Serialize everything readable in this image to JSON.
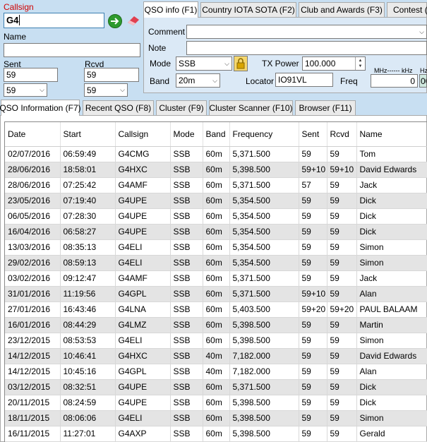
{
  "left": {
    "callsign_label": "Callsign",
    "callsign_value": "G4",
    "name_label": "Name",
    "name_value": "",
    "sent_label": "Sent",
    "sent_value": "59",
    "sent_select": "59",
    "rcvd_label": "Rcvd",
    "rcvd_value": "59",
    "rcvd_select": "59"
  },
  "top_tabs": [
    {
      "label": "QSO info (F1)"
    },
    {
      "label": "Country IOTA SOTA (F2)"
    },
    {
      "label": "Club and Awards (F3)"
    },
    {
      "label": "Contest (F"
    }
  ],
  "qso_panel": {
    "comment_label": "Comment",
    "comment_value": "",
    "note_label": "Note",
    "note_value": "",
    "mode_label": "Mode",
    "mode_value": "SSB",
    "tx_power_label": "TX Power",
    "tx_power_value": "100.000",
    "band_label": "Band",
    "band_value": "20m",
    "locator_label": "Locator",
    "locator_value": "IO91VL",
    "freq_label": "Freq",
    "mhz_khz_label": "MHz------ kHz",
    "hz_label": "Hz",
    "freq_khz_value": "0",
    "freq_hz_value": "00"
  },
  "bottom_tabs": [
    {
      "label": "QSO Information (F7)"
    },
    {
      "label": "Recent QSO (F8)"
    },
    {
      "label": "Cluster (F9)"
    },
    {
      "label": "Cluster Scanner (F10)"
    },
    {
      "label": "Browser (F11)"
    }
  ],
  "table": {
    "headers": [
      "Date",
      "Start",
      "Callsign",
      "Mode",
      "Band",
      "Frequency",
      "Sent",
      "Rcvd",
      "Name"
    ],
    "rows": [
      [
        "02/07/2016",
        "06:59:49",
        "G4CMG",
        "SSB",
        "60m",
        "5,371.500",
        "59",
        "59",
        "Tom"
      ],
      [
        "28/06/2016",
        "18:58:01",
        "G4HXC",
        "SSB",
        "60m",
        "5,398.500",
        "59+10",
        "59+10",
        "David Edwards"
      ],
      [
        "28/06/2016",
        "07:25:42",
        "G4AMF",
        "SSB",
        "60m",
        "5,371.500",
        "57",
        "59",
        "Jack"
      ],
      [
        "23/05/2016",
        "07:19:40",
        "G4UPE",
        "SSB",
        "60m",
        "5,354.500",
        "59",
        "59",
        "Dick"
      ],
      [
        "06/05/2016",
        "07:28:30",
        "G4UPE",
        "SSB",
        "60m",
        "5,354.500",
        "59",
        "59",
        "Dick"
      ],
      [
        "16/04/2016",
        "06:58:27",
        "G4UPE",
        "SSB",
        "60m",
        "5,354.500",
        "59",
        "59",
        "Dick"
      ],
      [
        "13/03/2016",
        "08:35:13",
        "G4ELI",
        "SSB",
        "60m",
        "5,354.500",
        "59",
        "59",
        "Simon"
      ],
      [
        "29/02/2016",
        "08:59:13",
        "G4ELI",
        "SSB",
        "60m",
        "5,354.500",
        "59",
        "59",
        "Simon"
      ],
      [
        "03/02/2016",
        "09:12:47",
        "G4AMF",
        "SSB",
        "60m",
        "5,371.500",
        "59",
        "59",
        "Jack"
      ],
      [
        "31/01/2016",
        "11:19:56",
        "G4GPL",
        "SSB",
        "60m",
        "5,371.500",
        "59+10",
        "59",
        "Alan"
      ],
      [
        "27/01/2016",
        "16:43:46",
        "G4LNA",
        "SSB",
        "60m",
        "5,403.500",
        "59+20",
        "59+20",
        "PAUL BALAAM"
      ],
      [
        "16/01/2016",
        "08:44:29",
        "G4LMZ",
        "SSB",
        "60m",
        "5,398.500",
        "59",
        "59",
        "Martin"
      ],
      [
        "23/12/2015",
        "08:53:53",
        "G4ELI",
        "SSB",
        "60m",
        "5,398.500",
        "59",
        "59",
        "Simon"
      ],
      [
        "14/12/2015",
        "10:46:41",
        "G4HXC",
        "SSB",
        "40m",
        "7,182.000",
        "59",
        "59",
        "David Edwards"
      ],
      [
        "14/12/2015",
        "10:45:16",
        "G4GPL",
        "SSB",
        "40m",
        "7,182.000",
        "59",
        "59",
        "Alan"
      ],
      [
        "03/12/2015",
        "08:32:51",
        "G4UPE",
        "SSB",
        "60m",
        "5,371.500",
        "59",
        "59",
        "Dick"
      ],
      [
        "20/11/2015",
        "08:24:59",
        "G4UPE",
        "SSB",
        "60m",
        "5,398.500",
        "59",
        "59",
        "Dick"
      ],
      [
        "18/11/2015",
        "08:06:06",
        "G4ELI",
        "SSB",
        "60m",
        "5,398.500",
        "59",
        "59",
        "Simon"
      ],
      [
        "16/11/2015",
        "11:27:01",
        "G4AXP",
        "SSB",
        "60m",
        "5,398.500",
        "59",
        "59",
        "Gerald"
      ]
    ]
  }
}
